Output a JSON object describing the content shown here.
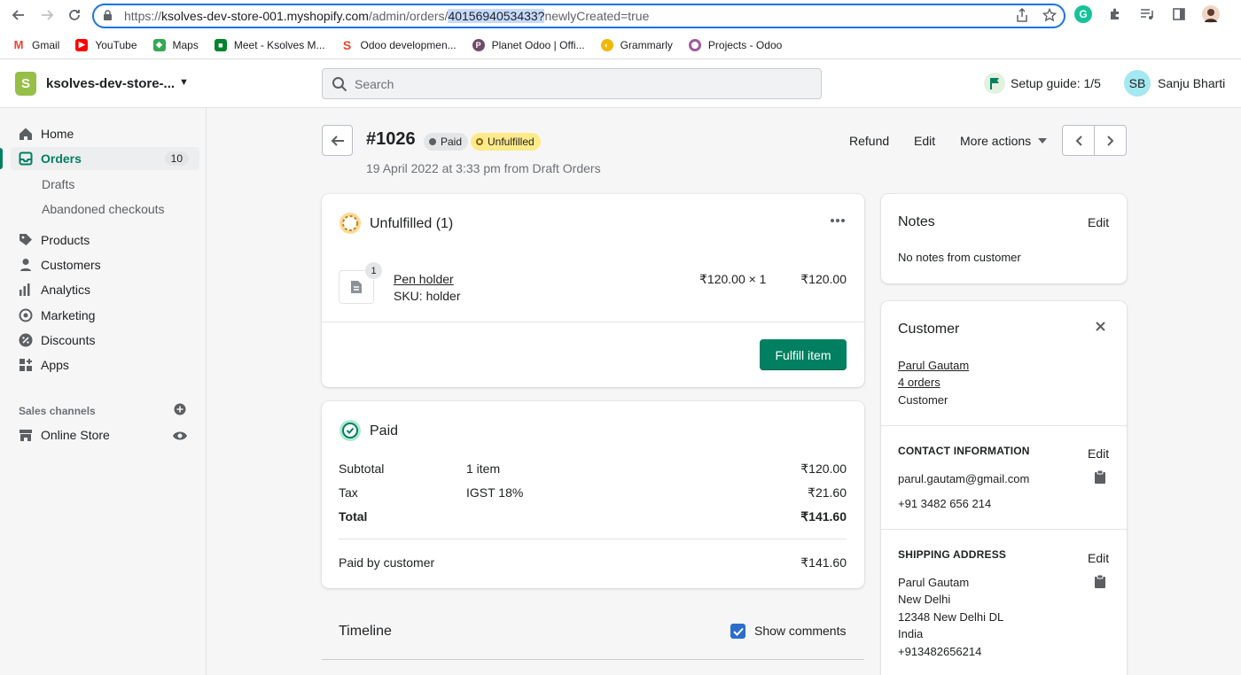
{
  "browser": {
    "url_scheme": "https://",
    "url_host": "ksolves-dev-store-001.myshopify.com",
    "url_path": "/admin/orders/",
    "url_selected": "4015694053433?",
    "url_query": "newlyCreated=true",
    "bookmarks": [
      "Gmail",
      "YouTube",
      "Maps",
      "Meet - Ksolves M...",
      "Odoo developmen...",
      "Planet Odoo | Offi...",
      "Grammarly",
      "Projects - Odoo"
    ]
  },
  "topbar": {
    "store_name": "ksolves-dev-store-...",
    "search_placeholder": "Search",
    "setup_guide": "Setup guide: 1/5",
    "avatar_initials": "SB",
    "user_name": "Sanju Bharti"
  },
  "sidebar": {
    "home": "Home",
    "orders": "Orders",
    "orders_count": "10",
    "drafts": "Drafts",
    "abandoned": "Abandoned checkouts",
    "products": "Products",
    "customers": "Customers",
    "analytics": "Analytics",
    "marketing": "Marketing",
    "discounts": "Discounts",
    "apps": "Apps",
    "sales_channels": "Sales channels",
    "online_store": "Online Store"
  },
  "order": {
    "number": "#1026",
    "badge_paid": "Paid",
    "badge_unfulfilled": "Unfulfilled",
    "subtitle": "19 April 2022 at 3:33 pm from Draft Orders",
    "actions": {
      "refund": "Refund",
      "edit": "Edit",
      "more": "More actions"
    }
  },
  "unfulfilled": {
    "title": "Unfulfilled (1)",
    "item_qty": "1",
    "item_name": "Pen holder",
    "item_sku": "SKU: holder",
    "item_price": "₹120.00 × 1",
    "item_total": "₹120.00",
    "fulfill_button": "Fulfill item"
  },
  "paid": {
    "title": "Paid",
    "subtotal_label": "Subtotal",
    "subtotal_detail": "1 item",
    "subtotal_value": "₹120.00",
    "tax_label": "Tax",
    "tax_detail": "IGST 18%",
    "tax_value": "₹21.60",
    "total_label": "Total",
    "total_value": "₹141.60",
    "paid_by_label": "Paid by customer",
    "paid_by_value": "₹141.60"
  },
  "timeline": {
    "title": "Timeline",
    "show_comments": "Show comments"
  },
  "notes": {
    "title": "Notes",
    "edit": "Edit",
    "text": "No notes from customer"
  },
  "customer": {
    "title": "Customer",
    "name": "Parul Gautam",
    "orders": "4 orders",
    "label": "Customer",
    "contact_title": "CONTACT INFORMATION",
    "contact_edit": "Edit",
    "email": "parul.gautam@gmail.com",
    "phone": "+91 3482 656 214",
    "shipping_title": "SHIPPING ADDRESS",
    "shipping_edit": "Edit",
    "address": [
      "Parul Gautam",
      "New Delhi",
      "12348 New Delhi DL",
      "India",
      "+913482656214"
    ]
  },
  "colors": {
    "accent": "#008060",
    "link": "#2c6ecb",
    "unfulfilled_badge": "#ffea8a",
    "paid_badge": "#e4e5e7"
  }
}
